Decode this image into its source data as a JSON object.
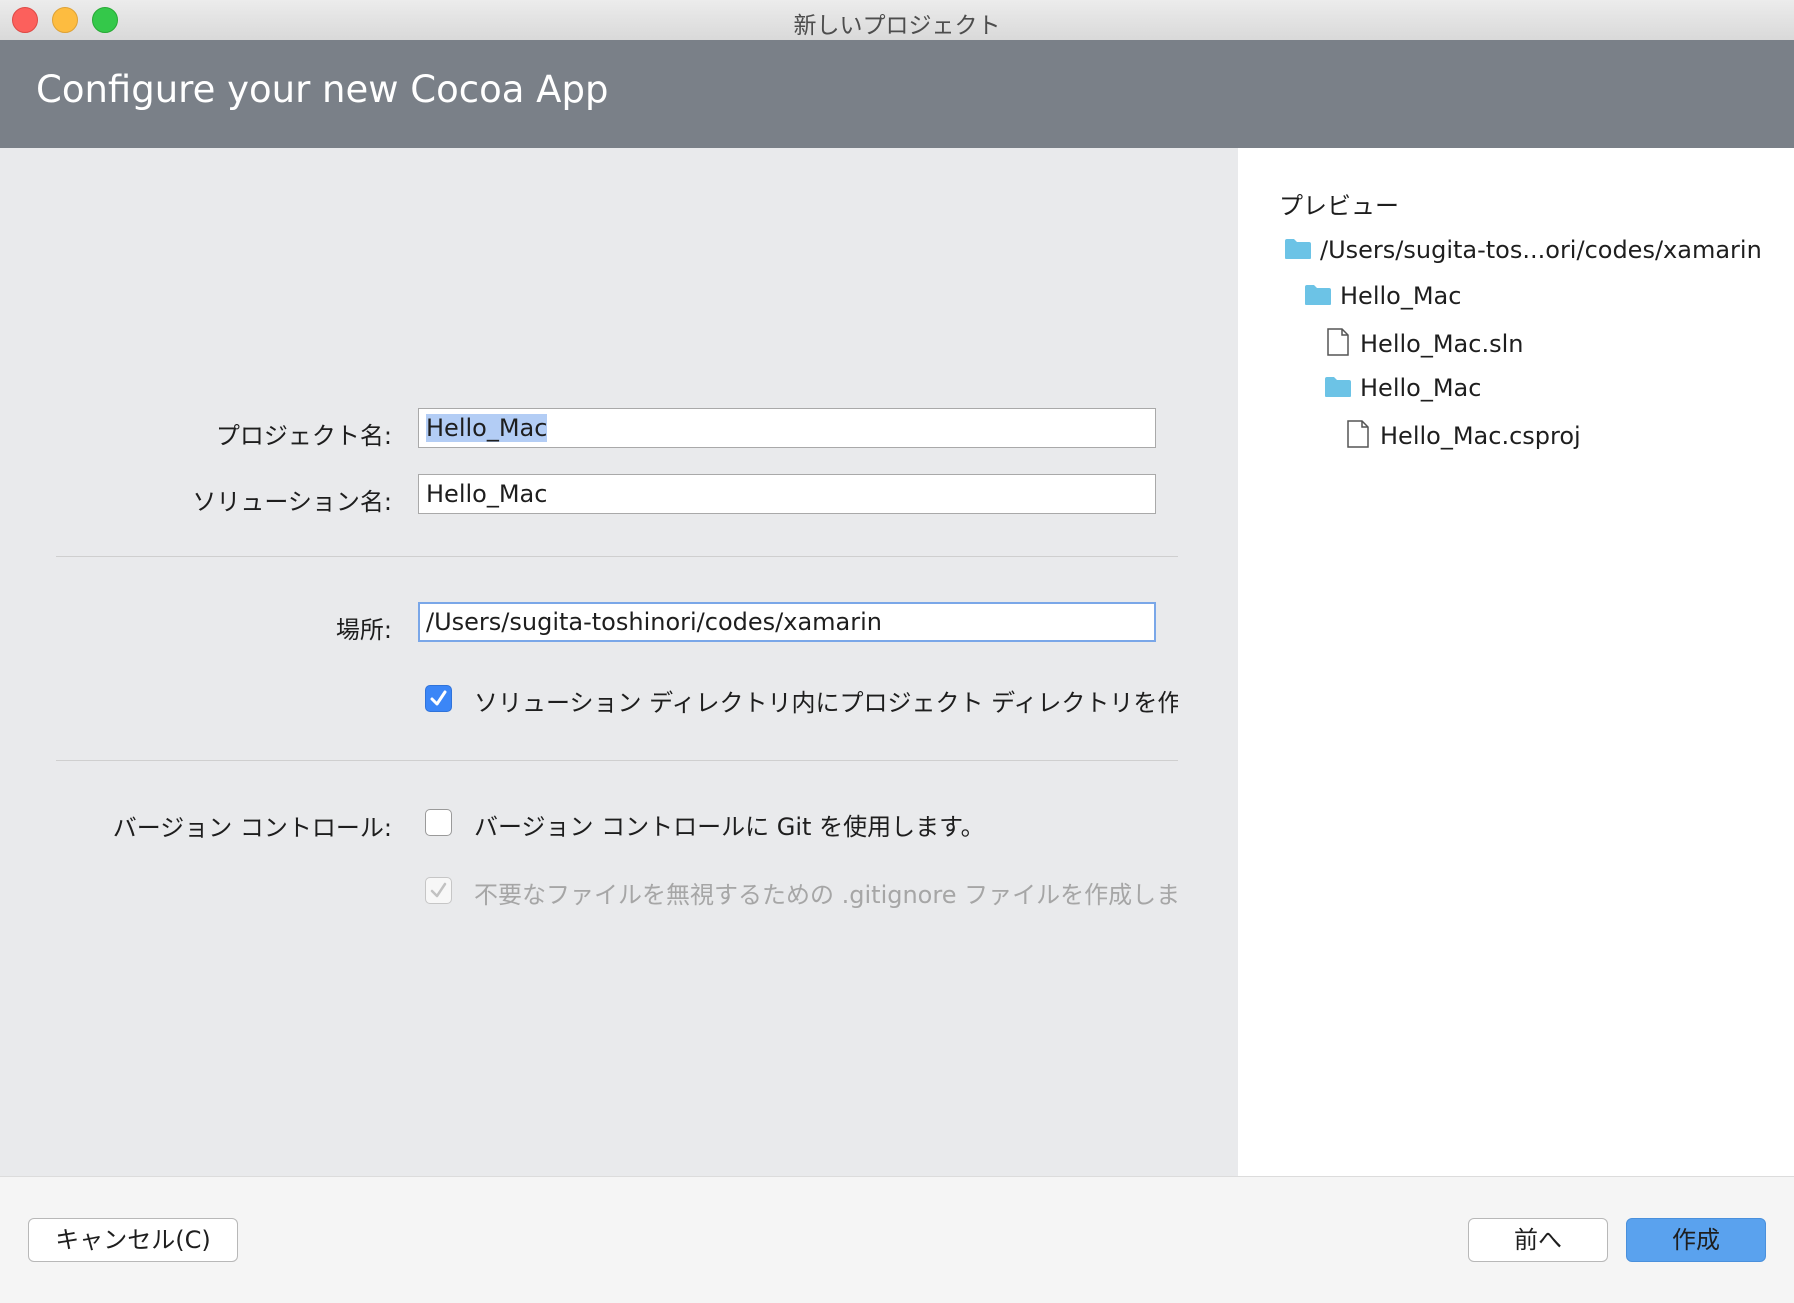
{
  "window": {
    "title": "新しいプロジェクト"
  },
  "header": {
    "title": "Configure your new Cocoa App"
  },
  "form": {
    "project_name_label": "プロジェクト名:",
    "project_name_value": "Hello_Mac",
    "solution_name_label": "ソリューション名:",
    "solution_name_value": "Hello_Mac",
    "location_label": "場所:",
    "location_value": "/Users/sugita-toshinori/codes/xamarin",
    "create_dir_checkbox_label": "ソリューション ディレクトリ内にプロジェクト ディレクトリを作",
    "create_dir_checked": true,
    "version_control_label": "バージョン コントロール:",
    "use_git_label": "バージョン コントロールに Git を使用します。",
    "use_git_checked": false,
    "gitignore_label": "不要なファイルを無視するための .gitignore ファイルを作成しま",
    "gitignore_checked": true,
    "gitignore_disabled": true
  },
  "preview": {
    "title": "プレビュー",
    "items": [
      {
        "type": "folder",
        "name": "/Users/sugita-tos...ori/codes/xamarin"
      },
      {
        "type": "folder",
        "name": "Hello_Mac"
      },
      {
        "type": "file",
        "name": "Hello_Mac.sln"
      },
      {
        "type": "folder",
        "name": "Hello_Mac"
      },
      {
        "type": "file",
        "name": "Hello_Mac.csproj"
      }
    ]
  },
  "footer": {
    "cancel_label": "キャンセル(C)",
    "back_label": "前へ",
    "create_label": "作成"
  },
  "colors": {
    "header_bg": "#7a8088",
    "folder_icon": "#6cc3e6",
    "primary_button": "#5aa2ee",
    "checkbox_on": "#3b86f7"
  }
}
